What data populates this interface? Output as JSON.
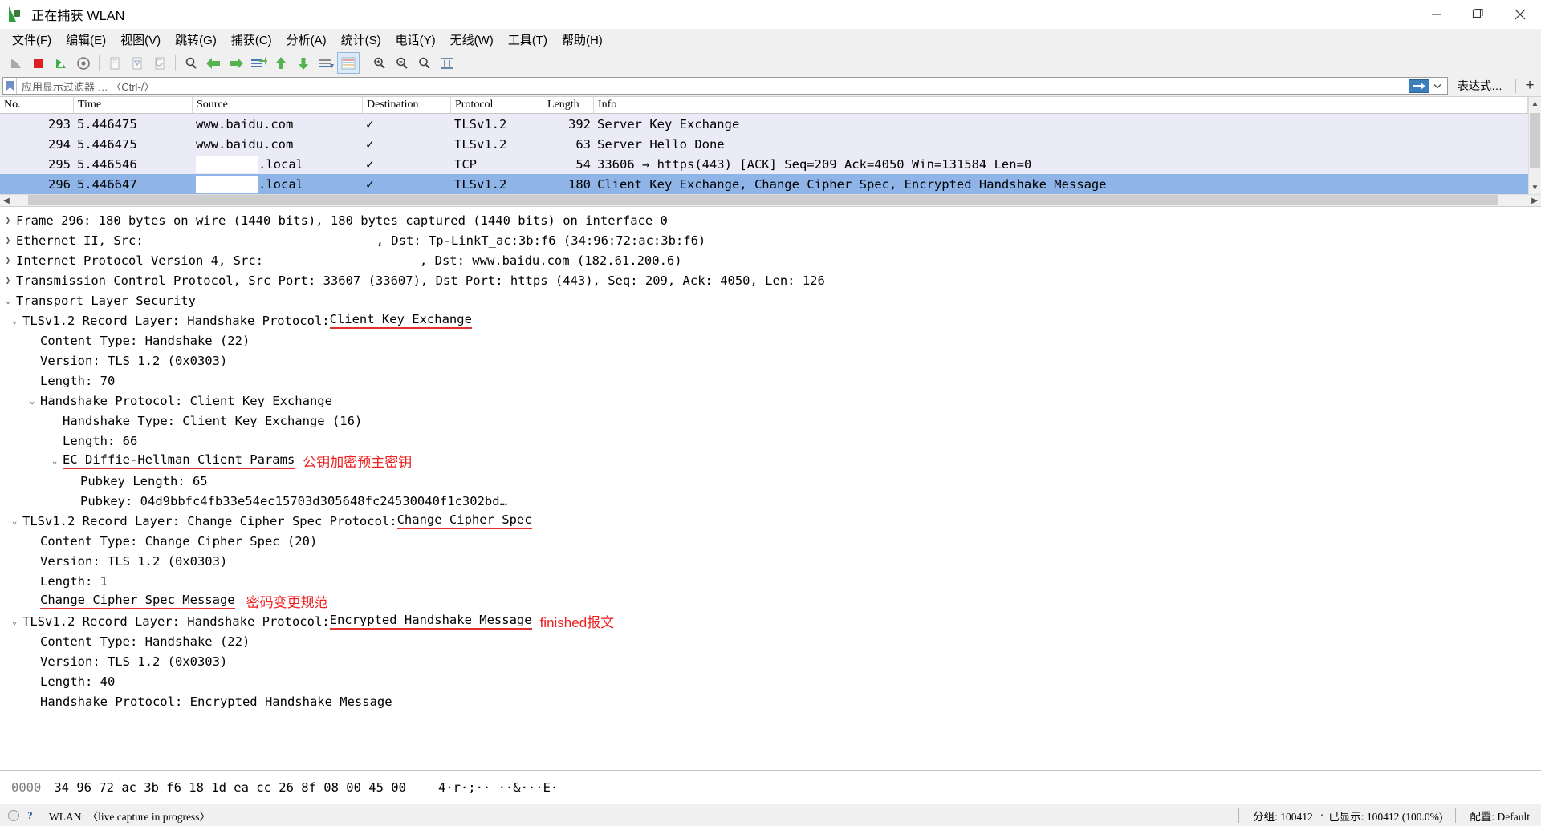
{
  "window": {
    "title": "正在捕获 WLAN",
    "icon": "wireshark-shark-fin-icon",
    "controls": {
      "minimize": "minimize-icon",
      "maximize": "maximize-icon",
      "close": "close-icon"
    }
  },
  "menubar": {
    "items": [
      {
        "label": "文件(F)",
        "name": "menu-file"
      },
      {
        "label": "编辑(E)",
        "name": "menu-edit"
      },
      {
        "label": "视图(V)",
        "name": "menu-view"
      },
      {
        "label": "跳转(G)",
        "name": "menu-go"
      },
      {
        "label": "捕获(C)",
        "name": "menu-capture"
      },
      {
        "label": "分析(A)",
        "name": "menu-analyze"
      },
      {
        "label": "统计(S)",
        "name": "menu-statistics"
      },
      {
        "label": "电话(Y)",
        "name": "menu-telephony"
      },
      {
        "label": "无线(W)",
        "name": "menu-wireless"
      },
      {
        "label": "工具(T)",
        "name": "menu-tools"
      },
      {
        "label": "帮助(H)",
        "name": "menu-help"
      }
    ]
  },
  "toolbar": {
    "buttons": [
      "start-capture-icon",
      "stop-capture-icon",
      "restart-capture-icon",
      "capture-options-icon",
      "open-file-icon",
      "save-file-icon",
      "close-file-icon",
      "reload-file-icon",
      "find-packet-icon",
      "go-back-icon",
      "go-forward-icon",
      "go-to-packet-icon",
      "go-first-packet-icon",
      "go-last-packet-icon",
      "auto-scroll-icon",
      "colorize-icon",
      "zoom-in-icon",
      "zoom-out-icon",
      "zoom-reset-icon",
      "resize-columns-icon"
    ]
  },
  "filter": {
    "bookmark_icon": "filter-bookmark-icon",
    "value": "",
    "placeholder": "应用显示过滤器 … 〈Ctrl-/〉",
    "apply_icon": "apply-filter-arrow-icon",
    "dropdown_icon": "chevron-down-icon",
    "expression_label": "表达式…",
    "add_label": "+"
  },
  "packet_list": {
    "columns": [
      "No.",
      "Time",
      "Source",
      "Destination",
      "Protocol",
      "Length",
      "Info"
    ],
    "rows": [
      {
        "no": "293",
        "time": "5.446475",
        "source": "www.baidu.com",
        "source_redacted": false,
        "destination": "✓",
        "protocol": "TLSv1.2",
        "length": "392",
        "info": "Server Key Exchange",
        "selected": false
      },
      {
        "no": "294",
        "time": "5.446475",
        "source": "www.baidu.com",
        "source_redacted": false,
        "destination": "✓",
        "protocol": "TLSv1.2",
        "length": "63",
        "info": "Server Hello Done",
        "selected": false
      },
      {
        "no": "295",
        "time": "5.446546",
        "source": ".local",
        "source_redacted": true,
        "destination": "✓",
        "protocol": "TCP",
        "length": "54",
        "info": "33606 → https(443) [ACK] Seq=209 Ack=4050 Win=131584 Len=0",
        "selected": false
      },
      {
        "no": "296",
        "time": "5.446647",
        "source": ".local",
        "source_redacted": true,
        "destination": "✓",
        "protocol": "TLSv1.2",
        "length": "180",
        "info": "Client Key Exchange, Change Cipher Spec, Encrypted Handshake Message",
        "selected": true
      }
    ]
  },
  "detail_tree": [
    {
      "indent": 0,
      "twisty": "collapsed",
      "text": "Frame 296: 180 bytes on wire (1440 bits), 180 bytes captured (1440 bits) on interface 0"
    },
    {
      "indent": 0,
      "twisty": "collapsed",
      "text_pre": "Ethernet II, Src:",
      "redacted": true,
      "text_post": ", Dst: Tp-LinkT_ac:3b:f6 (34:96:72:ac:3b:f6)"
    },
    {
      "indent": 0,
      "twisty": "collapsed",
      "text_pre": "Internet Protocol Version 4, Src:",
      "redacted": true,
      "text_post": ", Dst: www.baidu.com (182.61.200.6)"
    },
    {
      "indent": 0,
      "twisty": "collapsed",
      "text": "Transmission Control Protocol, Src Port: 33607 (33607), Dst Port: https (443), Seq: 209, Ack: 4050, Len: 126"
    },
    {
      "indent": 0,
      "twisty": "expanded",
      "text": "Transport Layer Security"
    },
    {
      "indent": 1,
      "twisty": "expanded",
      "text_pre": "TLSv1.2 Record Layer: Handshake Protocol: ",
      "underlined": "Client Key Exchange"
    },
    {
      "indent": 2,
      "twisty": "none",
      "text": "Content Type: Handshake (22)"
    },
    {
      "indent": 2,
      "twisty": "none",
      "text": "Version: TLS 1.2 (0x0303)"
    },
    {
      "indent": 2,
      "twisty": "none",
      "text": "Length: 70"
    },
    {
      "indent": 2,
      "twisty": "expanded",
      "text": "Handshake Protocol: Client Key Exchange"
    },
    {
      "indent": 3,
      "twisty": "none",
      "text": "Handshake Type: Client Key Exchange (16)"
    },
    {
      "indent": 3,
      "twisty": "none",
      "text": "Length: 66"
    },
    {
      "indent": 3,
      "twisty": "expanded",
      "underlined": "EC Diffie-Hellman Client Params",
      "annotation": "公钥加密预主密钥"
    },
    {
      "indent": 4,
      "twisty": "none",
      "text": "Pubkey Length: 65"
    },
    {
      "indent": 4,
      "twisty": "none",
      "text": "Pubkey: 04d9bbfc4fb33e54ec15703d305648fc24530040f1c302bd…"
    },
    {
      "indent": 1,
      "twisty": "expanded",
      "text_pre": "TLSv1.2 Record Layer: Change Cipher Spec Protocol: ",
      "underlined": "Change Cipher Spec"
    },
    {
      "indent": 2,
      "twisty": "none",
      "text": "Content Type: Change Cipher Spec (20)"
    },
    {
      "indent": 2,
      "twisty": "none",
      "text": "Version: TLS 1.2 (0x0303)"
    },
    {
      "indent": 2,
      "twisty": "none",
      "text": "Length: 1"
    },
    {
      "indent": 2,
      "twisty": "none",
      "underlined": "Change Cipher Spec Message",
      "annotation": "密码变更规范"
    },
    {
      "indent": 1,
      "twisty": "expanded",
      "text_pre": "TLSv1.2 Record Layer: Handshake Protocol: ",
      "underlined": "Encrypted Handshake Message",
      "annotation": "finished报文"
    },
    {
      "indent": 2,
      "twisty": "none",
      "text": "Content Type: Handshake (22)"
    },
    {
      "indent": 2,
      "twisty": "none",
      "text": "Version: TLS 1.2 (0x0303)"
    },
    {
      "indent": 2,
      "twisty": "none",
      "text": "Length: 40"
    },
    {
      "indent": 2,
      "twisty": "none",
      "text": "Handshake Protocol: Encrypted Handshake Message"
    }
  ],
  "bytes_pane": {
    "offset": "0000",
    "hex": "34 96 72 ac 3b f6 18 1d  ea cc 26 8f 08 00 45 00",
    "ascii": "4·r·;·· ··&···E·"
  },
  "statusbar": {
    "capture_icon": "capture-status-icon",
    "help_icon": "expert-info-icon",
    "interface_text": "WLAN: 〈live capture in progress〉",
    "packets_label": "分组: 100412",
    "separator_dot": "·",
    "displayed_label": "已显示: 100412 (100.0%)",
    "profile_label": "配置: Default"
  },
  "colors": {
    "selected_row": "#8fb4e8",
    "alt_row": "#ebebf8",
    "annotation_red": "#ee2020",
    "underline_red": "#e03030",
    "chrome_gray": "#f0f0f0"
  }
}
